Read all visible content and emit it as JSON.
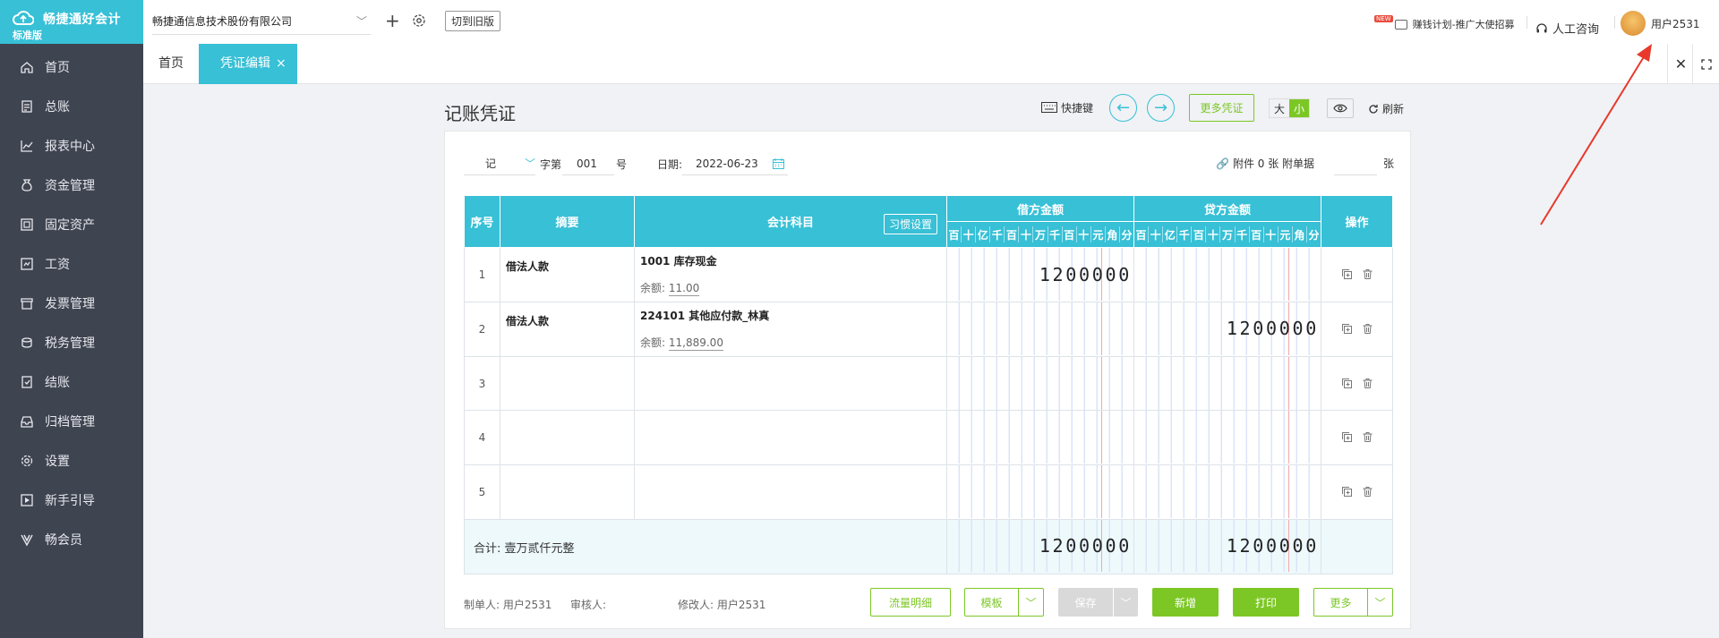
{
  "app": {
    "logo_name": "畅捷通好会计",
    "edition": "标准版"
  },
  "sidebar": {
    "items": [
      {
        "label": "首页",
        "icon": "home-icon"
      },
      {
        "label": "总账",
        "icon": "ledger-icon"
      },
      {
        "label": "报表中心",
        "icon": "chart-icon"
      },
      {
        "label": "资金管理",
        "icon": "money-icon"
      },
      {
        "label": "固定资产",
        "icon": "asset-icon"
      },
      {
        "label": "工资",
        "icon": "salary-icon"
      },
      {
        "label": "发票管理",
        "icon": "invoice-icon"
      },
      {
        "label": "税务管理",
        "icon": "tax-icon"
      },
      {
        "label": "结账",
        "icon": "close-books-icon"
      },
      {
        "label": "归档管理",
        "icon": "archive-icon"
      },
      {
        "label": "设置",
        "icon": "gear-icon"
      },
      {
        "label": "新手引导",
        "icon": "guide-icon"
      },
      {
        "label": "畅会员",
        "icon": "vip-icon"
      }
    ]
  },
  "header": {
    "company": "畅捷通信息技术股份有限公司",
    "old_version": "切到旧版",
    "new_tag": "NEW",
    "promo": "赚钱计划-推广大使招募",
    "consult": "人工咨询",
    "user": "用户2531"
  },
  "tabs": {
    "home": "首页",
    "active": "凭证编辑"
  },
  "voucher": {
    "title": "记账凭证",
    "shortcut": "快捷键",
    "more_vouchers": "更多凭证",
    "size_large": "大",
    "size_small": "小",
    "refresh": "刷新",
    "word": "记",
    "word_label": "字第",
    "number": "001",
    "number_unit": "号",
    "date_label": "日期:",
    "date": "2022-06-23",
    "attachment": "附件 0 张",
    "attach_label": "附单据",
    "attach_unit": "张",
    "headers": {
      "seq": "序号",
      "summary": "摘要",
      "subject": "会计科目",
      "habit": "习惯设置",
      "debit": "借方金额",
      "credit": "贷方金额",
      "ops": "操作"
    },
    "digit_units": [
      "百",
      "十",
      "亿",
      "千",
      "百",
      "十",
      "万",
      "千",
      "百",
      "十",
      "元",
      "角",
      "分"
    ],
    "rows": [
      {
        "seq": "1",
        "summary": "借法人款",
        "subject": "1001 库存现金",
        "balance_label": "余额:",
        "balance": "11.00",
        "debit": "1200000",
        "credit": ""
      },
      {
        "seq": "2",
        "summary": "借法人款",
        "subject": "224101 其他应付款_林真",
        "balance_label": "余额:",
        "balance": "11,889.00",
        "debit": "",
        "credit": "1200000"
      },
      {
        "seq": "3",
        "summary": "",
        "subject": "",
        "balance_label": "",
        "balance": "",
        "debit": "",
        "credit": ""
      },
      {
        "seq": "4",
        "summary": "",
        "subject": "",
        "balance_label": "",
        "balance": "",
        "debit": "",
        "credit": ""
      },
      {
        "seq": "5",
        "summary": "",
        "subject": "",
        "balance_label": "",
        "balance": "",
        "debit": "",
        "credit": ""
      }
    ],
    "total_label": "合计: 壹万贰仟元整",
    "total_debit": "1200000",
    "total_credit": "1200000",
    "maker": "制单人: 用户2531",
    "reviewer": "审核人:",
    "modifier": "修改人: 用户2531",
    "buttons": {
      "cashflow": "流量明细",
      "template": "模板",
      "save": "保存",
      "new": "新增",
      "print": "打印",
      "more": "更多"
    }
  },
  "colors": {
    "accent": "#37c0d6",
    "green": "#7cc726",
    "sidebar": "#3f4451",
    "arrow": "#e8392c"
  }
}
